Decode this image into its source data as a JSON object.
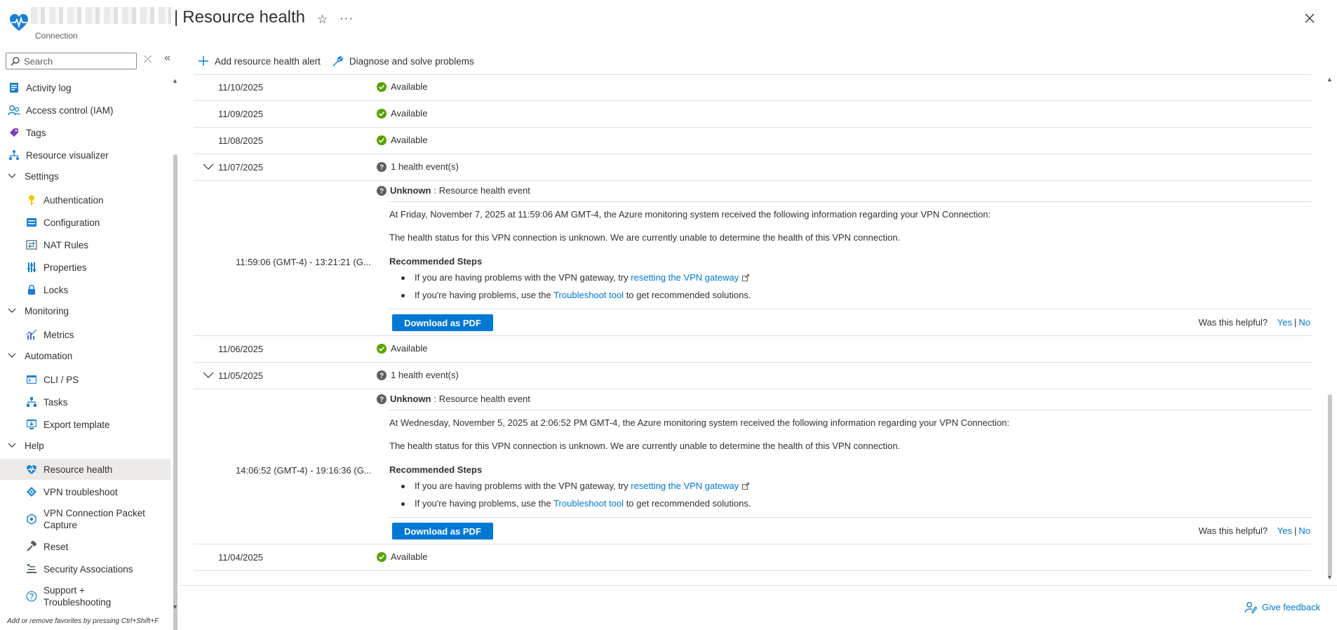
{
  "header": {
    "title": "Resource health",
    "separator": "|",
    "subtitle": "Connection",
    "star_glyph": "☆",
    "more_glyph": "···"
  },
  "sidebar": {
    "search_placeholder": "Search",
    "clear_glyph": "⤫",
    "collapse_glyph": "«",
    "items": [
      {
        "label": "Activity log",
        "icon": "activity-log-icon"
      },
      {
        "label": "Access control (IAM)",
        "icon": "iam-icon"
      },
      {
        "label": "Tags",
        "icon": "tag-icon"
      },
      {
        "label": "Resource visualizer",
        "icon": "visualizer-icon"
      },
      {
        "label": "Settings",
        "icon": "chevron-down-icon"
      },
      {
        "label": "Authentication",
        "icon": "key-icon"
      },
      {
        "label": "Configuration",
        "icon": "configuration-icon"
      },
      {
        "label": "NAT Rules",
        "icon": "nat-rules-icon"
      },
      {
        "label": "Properties",
        "icon": "properties-icon"
      },
      {
        "label": "Locks",
        "icon": "lock-icon"
      },
      {
        "label": "Monitoring",
        "icon": "chevron-down-icon"
      },
      {
        "label": "Metrics",
        "icon": "metrics-icon"
      },
      {
        "label": "Automation",
        "icon": "chevron-down-icon"
      },
      {
        "label": "CLI / PS",
        "icon": "cli-icon"
      },
      {
        "label": "Tasks",
        "icon": "tasks-icon"
      },
      {
        "label": "Export template",
        "icon": "export-template-icon"
      },
      {
        "label": "Help",
        "icon": "chevron-down-icon"
      },
      {
        "label": "Resource health",
        "icon": "heart-pulse-icon"
      },
      {
        "label": "VPN troubleshoot",
        "icon": "vpn-troubleshoot-icon"
      },
      {
        "label": "VPN Connection Packet Capture",
        "icon": "packet-capture-icon"
      },
      {
        "label": "Reset",
        "icon": "hammer-icon"
      },
      {
        "label": "Security Associations",
        "icon": "security-associations-icon"
      },
      {
        "label": "Support + Troubleshooting",
        "icon": "question-icon"
      }
    ],
    "favorites_hint": "Add or remove favorites by pressing Ctrl+Shift+F"
  },
  "toolbar": {
    "add_alert": "Add resource health alert",
    "diagnose": "Diagnose and solve problems"
  },
  "history": {
    "rows": [
      {
        "date": "11/10/2025",
        "status": "Available"
      },
      {
        "date": "11/09/2025",
        "status": "Available"
      },
      {
        "date": "11/08/2025",
        "status": "Available"
      },
      {
        "date": "11/07/2025",
        "status": "1 health event(s)"
      },
      {
        "date": "11/06/2025",
        "status": "Available"
      },
      {
        "date": "11/05/2025",
        "status": "1 health event(s)"
      },
      {
        "date": "11/04/2025",
        "status": "Available"
      }
    ],
    "events": [
      {
        "time_range": "11:59:06 (GMT-4) - 13:21:21 (G...",
        "severity": "Unknown",
        "colon_title": ": Resource health event",
        "intro": "At Friday, November 7, 2025 at 11:59:06 AM GMT-4, the Azure monitoring system received the following information regarding your VPN Connection:",
        "description": "The health status for this VPN connection is unknown. We are currently unable to determine the health of this VPN connection.",
        "steps_title": "Recommended Steps",
        "step1_prefix": "If you are having problems with the VPN gateway, try ",
        "step1_link": "resetting the VPN gateway",
        "step2_prefix": "If you're having problems, use the ",
        "step2_link": "Troubleshoot tool",
        "step2_suffix": " to get recommended solutions.",
        "download_label": "Download as PDF",
        "helpful_label": "Was this helpful?",
        "yes": "Yes",
        "pipe": "|",
        "no": "No"
      },
      {
        "time_range": "14:06:52 (GMT-4) - 19:16:36 (G...",
        "severity": "Unknown",
        "colon_title": ": Resource health event",
        "intro": "At Wednesday, November 5, 2025 at 2:06:52 PM GMT-4, the Azure monitoring system received the following information regarding your VPN Connection:",
        "description": "The health status for this VPN connection is unknown. We are currently unable to determine the health of this VPN connection.",
        "steps_title": "Recommended Steps",
        "step1_prefix": "If you are having problems with the VPN gateway, try ",
        "step1_link": "resetting the VPN gateway",
        "step2_prefix": "If you're having problems, use the ",
        "step2_link": "Troubleshoot tool",
        "step2_suffix": " to get recommended solutions.",
        "download_label": "Download as PDF",
        "helpful_label": "Was this helpful?",
        "yes": "Yes",
        "pipe": "|",
        "no": "No"
      }
    ]
  },
  "footer": {
    "feedback": "Give feedback"
  },
  "colors": {
    "accent": "#0078d4",
    "available": "#57a300",
    "unknown": "#605e5c",
    "active_bg": "#edebe9"
  }
}
